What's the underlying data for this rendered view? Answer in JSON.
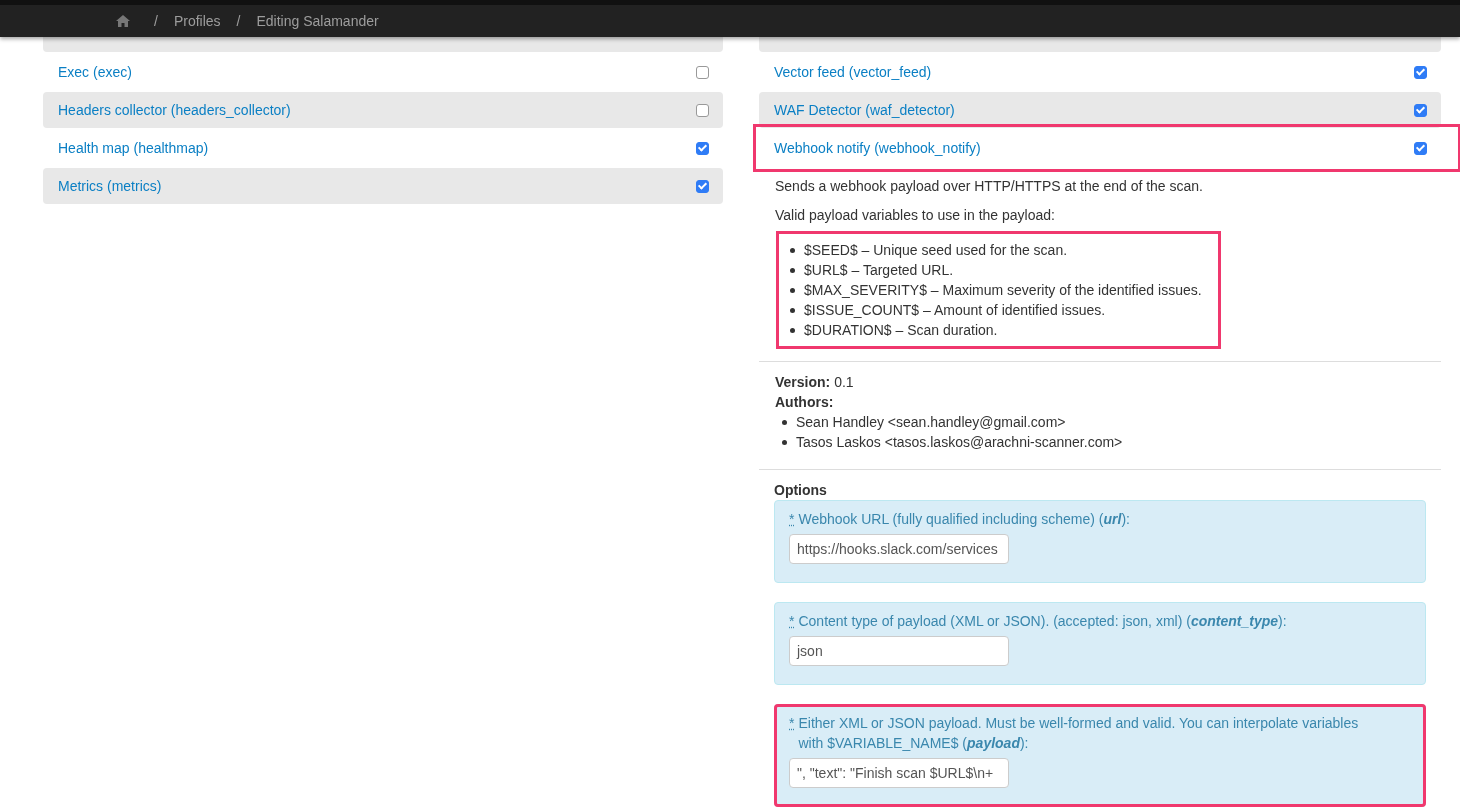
{
  "breadcrumb": [
    "Profiles",
    "Editing Salamander"
  ],
  "breadcrumb_separator": "/",
  "left_plugins": [
    {
      "kind": "partial"
    },
    {
      "kind": "plugin",
      "label": "Exec (exec)",
      "checked": false
    },
    {
      "kind": "plugin",
      "label": "Headers collector (headers_collector)",
      "checked": false
    },
    {
      "kind": "plugin",
      "label": "Health map (healthmap)",
      "checked": true
    },
    {
      "kind": "plugin",
      "label": "Metrics (metrics)",
      "checked": true
    }
  ],
  "right_plugins": [
    {
      "kind": "partial"
    },
    {
      "kind": "plugin",
      "label": "Vector feed (vector_feed)",
      "checked": true
    },
    {
      "kind": "plugin",
      "label": "WAF Detector (waf_detector)",
      "checked": true
    },
    {
      "kind": "plugin",
      "label": "Webhook notify (webhook_notify)",
      "checked": true,
      "highlighted": true
    }
  ],
  "details": {
    "description": "Sends a webhook payload over HTTP/HTTPS at the end of the scan.",
    "variables_intro": "Valid payload variables to use in the payload:",
    "variables_highlighted": true,
    "variables": [
      "$SEED$ – Unique seed used for the scan.",
      "$URL$ – Targeted URL.",
      "$MAX_SEVERITY$ – Maximum severity of the identified issues.",
      "$ISSUE_COUNT$ – Amount of identified issues.",
      "$DURATION$ – Scan duration."
    ],
    "version": "**Version:** 0.1",
    "authors_label": "Authors:",
    "authors": [
      "Sean Handley <sean.handley@gmail.com>",
      "Tasos Laskos <tasos.laskos@arachni-scanner.com>"
    ],
    "options_title": "Options",
    "options": [
      {
        "required_mark": "*",
        "label": "Webhook URL (fully qualified including scheme) (**url**):",
        "value": "https://hooks.slack.com/services",
        "highlighted": false
      },
      {
        "required_mark": "*",
        "label": "Content type of payload (XML or JSON). (accepted: json, xml) (**content_type**):",
        "value": "json",
        "highlighted": false
      },
      {
        "required_mark": "*",
        "label": "Either XML or JSON payload. Must be well-formed and valid. You can interpolate variables with $VARIABLE_NAME$ (**payload**):",
        "value": "\", \"text\": \"Finish scan $URL$\\n+",
        "highlighted": true
      }
    ]
  }
}
